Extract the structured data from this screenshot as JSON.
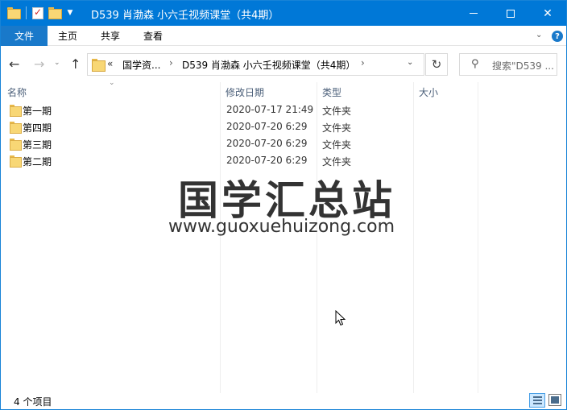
{
  "window": {
    "title": "D539 肖渤森 小六壬视频课堂（共4期）",
    "accent": "#0078d7"
  },
  "ribbon": {
    "file": "文件",
    "home": "主页",
    "share": "共享",
    "view": "查看",
    "help": "?"
  },
  "nav": {
    "overflow": "«",
    "breadcrumbs": [
      "国学资...",
      "D539 肖渤森 小六壬视频课堂（共4期）"
    ],
    "search_placeholder": "搜索\"D539 ..."
  },
  "columns": {
    "name": "名称",
    "date": "修改日期",
    "type": "类型",
    "size": "大小"
  },
  "rows": [
    {
      "name": "第一期",
      "date": "2020-07-17 21:49",
      "type": "文件夹",
      "size": ""
    },
    {
      "name": "第四期",
      "date": "2020-07-20 6:29",
      "type": "文件夹",
      "size": ""
    },
    {
      "name": "第三期",
      "date": "2020-07-20 6:29",
      "type": "文件夹",
      "size": ""
    },
    {
      "name": "第二期",
      "date": "2020-07-20 6:29",
      "type": "文件夹",
      "size": ""
    }
  ],
  "watermark": {
    "cn": "国学汇总站",
    "url": "www.guoxuehuizong.com"
  },
  "status": {
    "item_count": "4 个项目"
  }
}
